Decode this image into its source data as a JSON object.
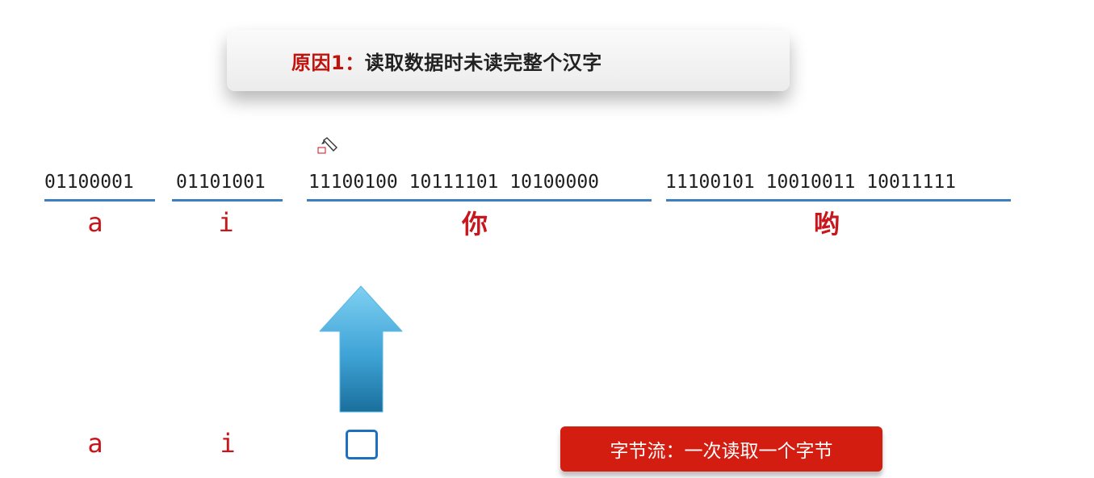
{
  "title": {
    "prefix": "原因1：",
    "text": "读取数据时未读完整个汉字"
  },
  "byte_groups": [
    {
      "bytes": "01100001",
      "char": "a"
    },
    {
      "bytes": "01101001",
      "char": "i"
    },
    {
      "bytes": "11100100 10111101 10100000",
      "char": "你"
    },
    {
      "bytes": "11100101 10010011 10011111",
      "char": "哟"
    }
  ],
  "decoded": [
    "a",
    "i"
  ],
  "note": "字节流：一次读取一个字节",
  "colors": {
    "accent_red": "#c8161d",
    "underline_blue": "#3f7fbf",
    "box_blue": "#1f6fc0",
    "note_red": "#d31d10"
  }
}
